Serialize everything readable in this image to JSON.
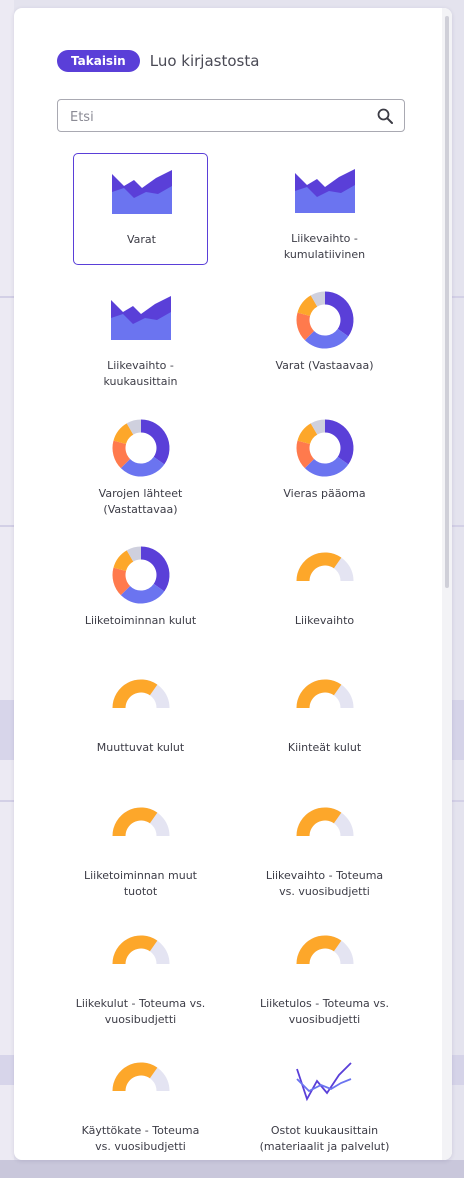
{
  "header": {
    "back_label": "Takaisin",
    "title": "Luo kirjastosta"
  },
  "search": {
    "placeholder": "Etsi",
    "value": ""
  },
  "colors": {
    "accent": "#5a3fd8",
    "chart_purple": "#5a3fd8",
    "chart_blue": "#6b74f0",
    "chart_orange": "#fda72a",
    "chart_coral": "#ff7a4d",
    "chart_gray": "#cfd0de"
  },
  "library": [
    {
      "label": "Varat",
      "icon": "area-chart-icon",
      "selected": true
    },
    {
      "label": "Liikevaihto - kumulatiivinen",
      "icon": "area-chart-icon",
      "selected": false
    },
    {
      "label": "Liikevaihto - kuukausittain",
      "icon": "area-chart-icon",
      "selected": false
    },
    {
      "label": "Varat (Vastaavaa)",
      "icon": "donut-chart-icon",
      "selected": false
    },
    {
      "label": "Varojen lähteet (Vastattavaa)",
      "icon": "donut-chart-icon",
      "selected": false
    },
    {
      "label": "Vieras pääoma",
      "icon": "donut-chart-icon",
      "selected": false
    },
    {
      "label": "Liiketoiminnan kulut",
      "icon": "donut-chart-icon",
      "selected": false
    },
    {
      "label": "Liikevaihto",
      "icon": "gauge-chart-icon",
      "selected": false
    },
    {
      "label": "Muuttuvat kulut",
      "icon": "gauge-chart-icon",
      "selected": false
    },
    {
      "label": "Kiinteät kulut",
      "icon": "gauge-chart-icon",
      "selected": false
    },
    {
      "label": "Liiketoiminnan muut tuotot",
      "icon": "gauge-chart-icon",
      "selected": false
    },
    {
      "label": "Liikevaihto - Toteuma vs. vuosibudjetti",
      "icon": "gauge-chart-icon",
      "selected": false
    },
    {
      "label": "Liikekulut - Toteuma vs. vuosibudjetti",
      "icon": "gauge-chart-icon",
      "selected": false
    },
    {
      "label": "Liiketulos - Toteuma vs. vuosibudjetti",
      "icon": "gauge-chart-icon",
      "selected": false
    },
    {
      "label": "Käyttökate - Toteuma vs. vuosibudjetti",
      "icon": "gauge-chart-icon",
      "selected": false
    },
    {
      "label": "Ostot kuukausittain (materiaalit ja palvelut)",
      "icon": "line-chart-icon",
      "selected": false
    }
  ]
}
